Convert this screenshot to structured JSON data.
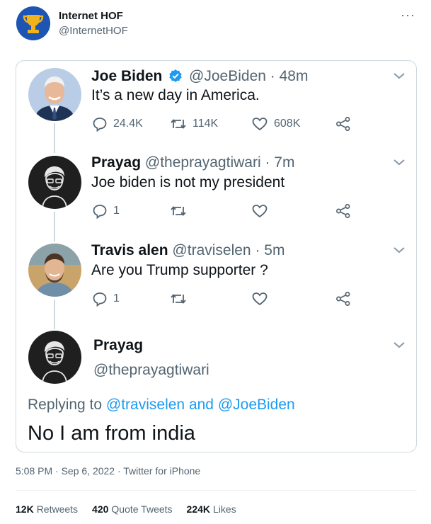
{
  "outer": {
    "name": "Internet HOF",
    "handle": "@InternetHOF",
    "more": "···",
    "avatar_color": "#1d55b4"
  },
  "tweets": [
    {
      "name": "Joe Biden",
      "verified": true,
      "handle_time": "@JoeBiden · 48m",
      "text": "It’s a new day in America.",
      "reply_count": "24.4K",
      "retweet_count": "114K",
      "like_count": "608K"
    },
    {
      "name": "Prayag",
      "handle_time": "@theprayagtiwari · 7m",
      "text": "Joe biden is not my president",
      "reply_count": "1",
      "retweet_count": "",
      "like_count": ""
    },
    {
      "name": "Travis alen",
      "handle_time": "@traviselen · 5m",
      "text": "Are you Trump supporter ?",
      "reply_count": "1",
      "retweet_count": "",
      "like_count": ""
    }
  ],
  "focus": {
    "name": "Prayag",
    "handle": "@theprayagtiwari",
    "replying_prefix": "Replying to ",
    "mention_1": "@traviselen",
    "and": " and ",
    "mention_2": "@JoeBiden",
    "text": "No I am from india"
  },
  "meta": "5:08 PM · Sep 6, 2022 · Twitter for iPhone",
  "stats": {
    "retweets_num": "12K",
    "retweets_label": "Retweets",
    "quotes_num": "420",
    "quotes_label": "Quote Tweets",
    "likes_num": "224K",
    "likes_label": "Likes"
  },
  "colors": {
    "accent": "#1d9bf0",
    "muted": "#536471",
    "verified": "#1d9bf0"
  }
}
